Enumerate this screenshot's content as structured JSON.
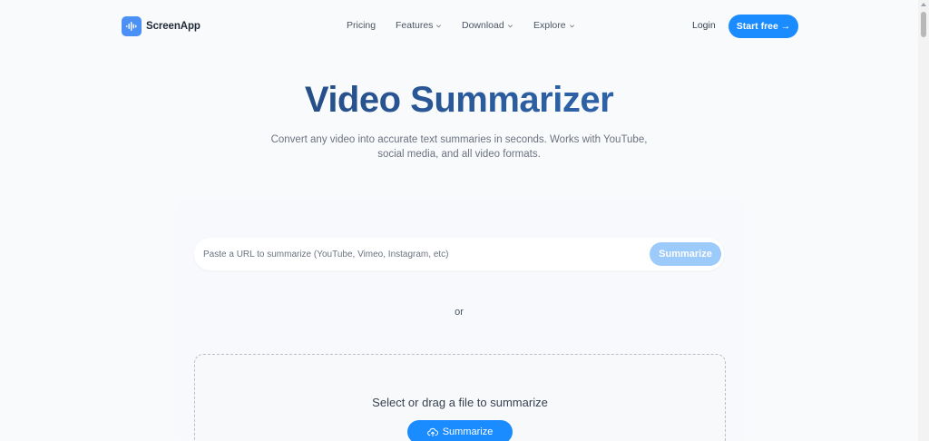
{
  "header": {
    "brand": "ScreenApp",
    "nav": [
      {
        "label": "Pricing",
        "has_dropdown": false
      },
      {
        "label": "Features",
        "has_dropdown": true
      },
      {
        "label": "Download",
        "has_dropdown": true
      },
      {
        "label": "Explore",
        "has_dropdown": true
      }
    ],
    "login_label": "Login",
    "start_label": "Start free →"
  },
  "hero": {
    "title": "Video Summarizer",
    "subtitle": "Convert any video into accurate text summaries in seconds. Works with YouTube, social media, and all video formats."
  },
  "url_form": {
    "placeholder": "Paste a URL to summarize (YouTube, Vimeo, Instagram, etc)",
    "value": "",
    "button_label": "Summarize"
  },
  "divider_text": "or",
  "upload": {
    "prompt": "Select or drag a file to summarize",
    "button_label": "Summarize",
    "button_icon": "cloud-upload-icon"
  },
  "colors": {
    "primary": "#1a8cff",
    "primary_disabled": "#9ccafb",
    "title_dark": "#1f3b66",
    "title_light": "#3a73c2",
    "logo_bg": "#4a90f5"
  }
}
